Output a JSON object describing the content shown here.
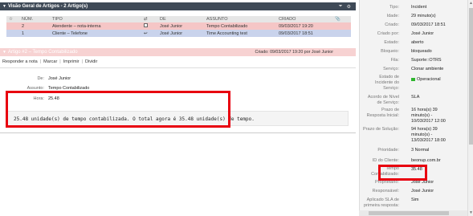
{
  "overview": {
    "title": "Visão Geral de Artigos - 2 Artigo(s)",
    "columns": [
      "NÚM.",
      "TIPO",
      "⇄",
      "DE",
      "ASSUNTO",
      "CRIADO",
      "📎"
    ],
    "rows": [
      {
        "num": "2",
        "tipo": "Atendente – nota-interna",
        "de": "José Junior",
        "assunto": "Tempo Contabilizado",
        "criado": "09/03/2017 19:20"
      },
      {
        "num": "1",
        "tipo": "Cliente – Telefone",
        "de": "José Junior",
        "assunto": "Time Accounting test",
        "criado": "09/03/2017 18:51"
      }
    ]
  },
  "article": {
    "title": "Artigo #2 – Tempo Contabilizado",
    "meta": "Criado: 09/03/2017 19:20 por José Junior",
    "actions": [
      "Responder a nota",
      "Marcar",
      "Imprimir",
      "Dividir"
    ],
    "fields": [
      {
        "label": "De:",
        "value": "José Junior"
      },
      {
        "label": "Assunto:",
        "value": "Tempo Contabilizado"
      },
      {
        "label": "Hora:",
        "value": "25.48"
      }
    ],
    "body": "25.48 unidade(s) de tempo contabilizada. O total agora é 35.48 unidade(s) de tempo."
  },
  "info": {
    "tipo": {
      "label": "Tipo:",
      "value": "Incident"
    },
    "idade": {
      "label": "Idade:",
      "value": "29 minuto(s)"
    },
    "criado": {
      "label": "Criado:",
      "value": "09/03/2017 18:51"
    },
    "criado_por": {
      "label": "Criado por:",
      "value": "José Junior"
    },
    "estado": {
      "label": "Estado:",
      "value": "aberto"
    },
    "bloqueio": {
      "label": "Bloqueio:",
      "value": "bloqueado"
    },
    "fila": {
      "label": "Fila:",
      "value": "Suporte::OTRS"
    },
    "servico": {
      "label": "Serviço:",
      "value": "Clonar ambiente"
    },
    "estado_incidente": {
      "label_lines": [
        "Estado de",
        "Incidente do",
        "Serviço:"
      ],
      "value": "Operacional"
    },
    "acordo": {
      "label_lines": [
        "Acordo de Nível",
        "de Serviço:"
      ],
      "value": "SLA"
    },
    "prazo_resp": {
      "label_lines": [
        "Prazo de",
        "Resposta Inicial:"
      ],
      "value_lines": [
        "16 hora(s) 39",
        "minuto(s) -",
        "10/03/2017 12:00"
      ]
    },
    "prazo_sol": {
      "label": "Prazo de Solução:",
      "value_lines": [
        "94 hora(s) 39",
        "minuto(s) -",
        "13/03/2017 18:00"
      ]
    },
    "prioridade": {
      "label": "Prioridade:",
      "value": "3 Normal"
    },
    "id_cliente": {
      "label": "ID do Cliente:",
      "value": "beonup.com.br"
    },
    "tempo": {
      "label_lines": [
        "Tempo",
        "Contabilizado:"
      ],
      "value": "35.48"
    },
    "proprietario": {
      "label": "Proprietário:",
      "value": "José Junior"
    },
    "responsavel": {
      "label": "Responsável:",
      "value": "José Junior"
    },
    "aplicado_sla": {
      "label_lines": [
        "Aplicado SLA de",
        "primeira resposta:"
      ],
      "value": "Sim"
    }
  },
  "colors": {
    "header": "#3f4a57",
    "row_internal": "#f5c6c6",
    "row_phone": "#c9d3ec",
    "highlight": "#e8000f",
    "article_bar": "#f7d2d2"
  }
}
